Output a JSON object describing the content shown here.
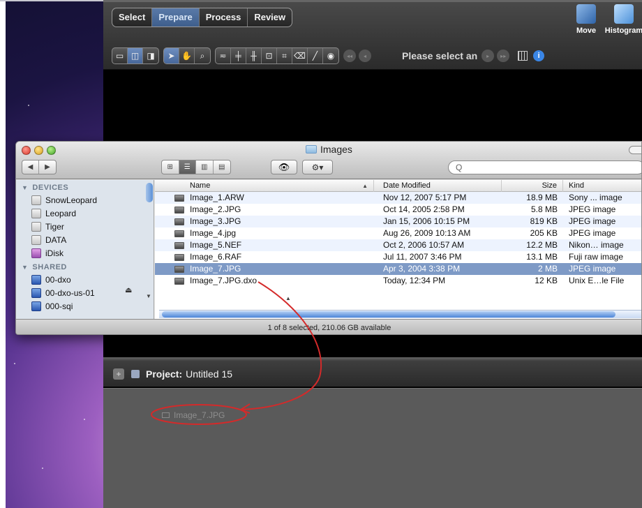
{
  "dxo": {
    "tabs": [
      {
        "label": "Select",
        "active": false
      },
      {
        "label": "Prepare",
        "active": true
      },
      {
        "label": "Process",
        "active": false
      },
      {
        "label": "Review",
        "active": false
      }
    ],
    "tools": {
      "move_label": "Move",
      "histogram_label": "Histogram"
    },
    "toolbar": {
      "status_text": "Please select an"
    }
  },
  "finder": {
    "title": "Images",
    "search": {
      "placeholder": "Q",
      "value": ""
    },
    "sidebar": {
      "devices_header": "DEVICES",
      "devices": [
        {
          "label": "SnowLeopard",
          "icon": "hard-drive-icon"
        },
        {
          "label": "Leopard",
          "icon": "hard-drive-icon"
        },
        {
          "label": "Tiger",
          "icon": "hard-drive-icon"
        },
        {
          "label": "DATA",
          "icon": "hard-drive-icon"
        },
        {
          "label": "iDisk",
          "icon": "idisk-icon"
        }
      ],
      "shared_header": "SHARED",
      "shared": [
        {
          "label": "00-dxo",
          "icon": "network-computer-icon"
        },
        {
          "label": "00-dxo-us-01",
          "icon": "network-computer-icon"
        },
        {
          "label": "000-sqi",
          "icon": "network-computer-icon"
        }
      ]
    },
    "columns": {
      "name": "Name",
      "date": "Date Modified",
      "size": "Size",
      "kind": "Kind"
    },
    "files": [
      {
        "name": "Image_1.ARW",
        "date": "Nov 12, 2007 5:17 PM",
        "size": "18.9 MB",
        "kind": "Sony ... image",
        "selected": false
      },
      {
        "name": "Image_2.JPG",
        "date": "Oct 14, 2005 2:58 PM",
        "size": "5.8 MB",
        "kind": "JPEG image",
        "selected": false
      },
      {
        "name": "Image_3.JPG",
        "date": "Jan 15, 2006 10:15 PM",
        "size": "819 KB",
        "kind": "JPEG image",
        "selected": false
      },
      {
        "name": "Image_4.jpg",
        "date": "Aug 26, 2009 10:13 AM",
        "size": "205 KB",
        "kind": "JPEG image",
        "selected": false
      },
      {
        "name": "Image_5.NEF",
        "date": "Oct 2, 2006 10:57 AM",
        "size": "12.2 MB",
        "kind": "Nikon… image",
        "selected": false
      },
      {
        "name": "Image_6.RAF",
        "date": "Jul 11, 2007 3:46 PM",
        "size": "13.1 MB",
        "kind": "Fuji raw image",
        "selected": false
      },
      {
        "name": "Image_7.JPG",
        "date": "Apr 3, 2004 3:38 PM",
        "size": "2 MB",
        "kind": "JPEG image",
        "selected": true
      },
      {
        "name": "Image_7.JPG.dxo",
        "date": "Today, 12:34 PM",
        "size": "12 KB",
        "kind": "Unix E…le File",
        "selected": false
      }
    ],
    "status": "1 of 8 selected, 210.06 GB available"
  },
  "project": {
    "label": "Project:",
    "name": "Untitled 15",
    "item": "Image_7.JPG"
  },
  "colors": {
    "annotation": "#d42a2a",
    "selection": "#7e9ac6",
    "active_tab": "#4a6a9a"
  }
}
